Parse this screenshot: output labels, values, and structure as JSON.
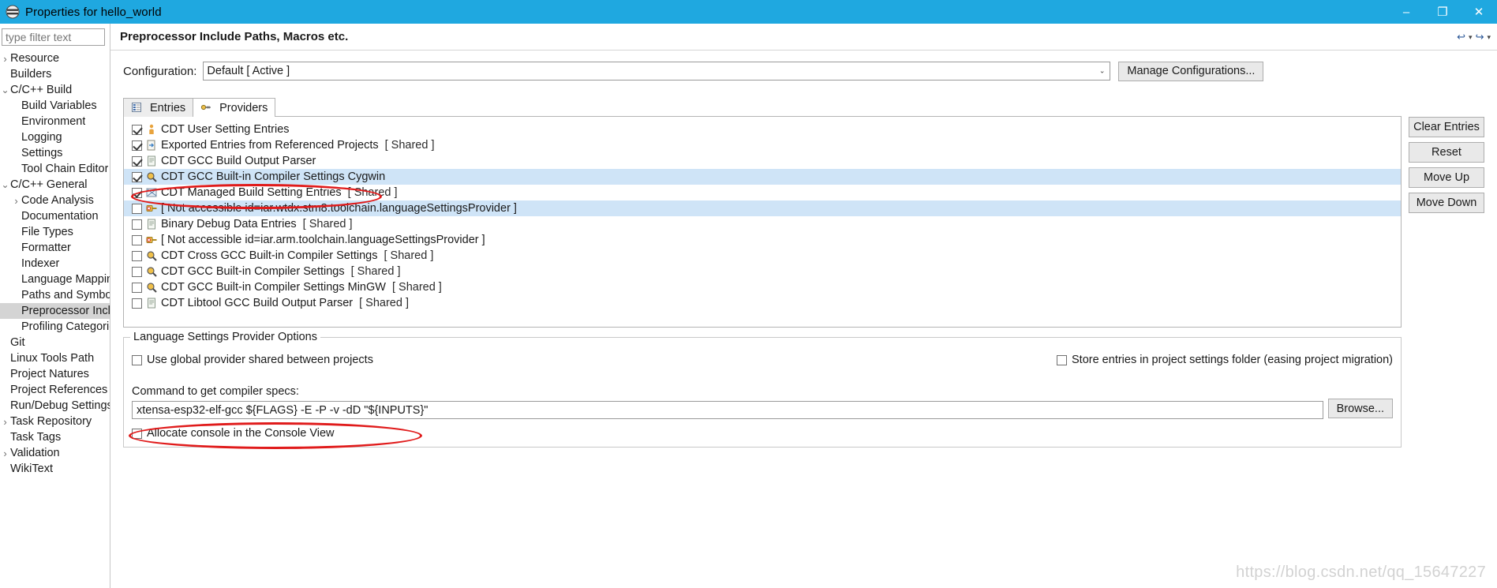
{
  "window": {
    "title": "Properties for hello_world",
    "icon": "eclipse-properties-icon",
    "minimize": "–",
    "maximize": "❐",
    "close": "✕",
    "titlebar_color": "#1fa8e0"
  },
  "sidebar": {
    "filter_placeholder": "type filter text",
    "filter_value": "",
    "items": [
      {
        "label": "Resource",
        "indent": 0,
        "twisty": "collapsed",
        "selected": false
      },
      {
        "label": "Builders",
        "indent": 0,
        "twisty": "none",
        "selected": false
      },
      {
        "label": "C/C++ Build",
        "indent": 0,
        "twisty": "expanded",
        "selected": false
      },
      {
        "label": "Build Variables",
        "indent": 1,
        "twisty": "none",
        "selected": false
      },
      {
        "label": "Environment",
        "indent": 1,
        "twisty": "none",
        "selected": false
      },
      {
        "label": "Logging",
        "indent": 1,
        "twisty": "none",
        "selected": false
      },
      {
        "label": "Settings",
        "indent": 1,
        "twisty": "none",
        "selected": false
      },
      {
        "label": "Tool Chain Editor",
        "indent": 1,
        "twisty": "none",
        "selected": false
      },
      {
        "label": "C/C++ General",
        "indent": 0,
        "twisty": "expanded",
        "selected": false
      },
      {
        "label": "Code Analysis",
        "indent": 1,
        "twisty": "collapsed",
        "selected": false
      },
      {
        "label": "Documentation",
        "indent": 1,
        "twisty": "none",
        "selected": false
      },
      {
        "label": "File Types",
        "indent": 1,
        "twisty": "none",
        "selected": false
      },
      {
        "label": "Formatter",
        "indent": 1,
        "twisty": "none",
        "selected": false
      },
      {
        "label": "Indexer",
        "indent": 1,
        "twisty": "none",
        "selected": false
      },
      {
        "label": "Language Mappings",
        "indent": 1,
        "twisty": "none",
        "selected": false
      },
      {
        "label": "Paths and Symbols",
        "indent": 1,
        "twisty": "none",
        "selected": false
      },
      {
        "label": "Preprocessor Include",
        "indent": 1,
        "twisty": "none",
        "selected": true
      },
      {
        "label": "Profiling Categories",
        "indent": 1,
        "twisty": "none",
        "selected": false
      },
      {
        "label": "Git",
        "indent": 0,
        "twisty": "none",
        "selected": false
      },
      {
        "label": "Linux Tools Path",
        "indent": 0,
        "twisty": "none",
        "selected": false
      },
      {
        "label": "Project Natures",
        "indent": 0,
        "twisty": "none",
        "selected": false
      },
      {
        "label": "Project References",
        "indent": 0,
        "twisty": "none",
        "selected": false
      },
      {
        "label": "Run/Debug Settings",
        "indent": 0,
        "twisty": "none",
        "selected": false
      },
      {
        "label": "Task Repository",
        "indent": 0,
        "twisty": "collapsed",
        "selected": false
      },
      {
        "label": "Task Tags",
        "indent": 0,
        "twisty": "none",
        "selected": false
      },
      {
        "label": "Validation",
        "indent": 0,
        "twisty": "collapsed",
        "selected": false
      },
      {
        "label": "WikiText",
        "indent": 0,
        "twisty": "none",
        "selected": false
      }
    ]
  },
  "page": {
    "title": "Preprocessor Include Paths, Macros etc.",
    "nav": {
      "back": "↩",
      "back_caret": "▾",
      "forward": "↪",
      "forward_caret": "▾"
    }
  },
  "configuration": {
    "label": "Configuration:",
    "value": "Default  [ Active ]",
    "arrow": "⌄",
    "manage_button": "Manage Configurations..."
  },
  "tabs": [
    {
      "label": "Entries",
      "icon": "entries-icon",
      "active": false
    },
    {
      "label": "Providers",
      "icon": "providers-icon",
      "active": true
    }
  ],
  "providers": [
    {
      "label": "CDT User Setting Entries",
      "checked": true,
      "shared": "",
      "icon": "person-icon",
      "highlight": false
    },
    {
      "label": "Exported Entries from Referenced Projects",
      "checked": true,
      "shared": "[ Shared ]",
      "icon": "export-icon",
      "highlight": false
    },
    {
      "label": "CDT GCC Build Output Parser",
      "checked": true,
      "shared": "",
      "icon": "parser-icon",
      "highlight": false
    },
    {
      "label": "CDT GCC Built-in Compiler Settings Cygwin",
      "checked": true,
      "shared": "",
      "icon": "magnifier-icon",
      "highlight": true
    },
    {
      "label": "CDT Managed Build Setting Entries",
      "checked": true,
      "shared": "[ Shared ]",
      "icon": "managed-icon",
      "highlight": false
    },
    {
      "label": "[ Not accessible id=iar.wtdx.stm8.toolchain.languageSettingsProvider ]",
      "checked": false,
      "shared": "",
      "icon": "error-plug-icon",
      "highlight": true
    },
    {
      "label": "Binary Debug Data Entries",
      "checked": false,
      "shared": "[ Shared ]",
      "icon": "parser-icon",
      "highlight": false
    },
    {
      "label": "[ Not accessible id=iar.arm.toolchain.languageSettingsProvider ]",
      "checked": false,
      "shared": "",
      "icon": "error-plug-icon",
      "highlight": false
    },
    {
      "label": "CDT Cross GCC Built-in Compiler Settings",
      "checked": false,
      "shared": "[ Shared ]",
      "icon": "magnifier-icon",
      "highlight": false
    },
    {
      "label": "CDT GCC Built-in Compiler Settings",
      "checked": false,
      "shared": "[ Shared ]",
      "icon": "magnifier-icon",
      "highlight": false
    },
    {
      "label": "CDT GCC Built-in Compiler Settings MinGW",
      "checked": false,
      "shared": "[ Shared ]",
      "icon": "magnifier-icon",
      "highlight": false
    },
    {
      "label": "CDT Libtool GCC Build Output Parser",
      "checked": false,
      "shared": "[ Shared ]",
      "icon": "parser-icon",
      "highlight": false
    }
  ],
  "side_buttons": [
    {
      "label": "Clear Entries"
    },
    {
      "label": "Reset"
    },
    {
      "label": "Move Up"
    },
    {
      "label": "Move Down"
    }
  ],
  "options": {
    "legend": "Language Settings Provider Options",
    "use_global": {
      "label": "Use global provider shared between projects",
      "checked": false
    },
    "store_entries": {
      "label": "Store entries in project settings folder (easing project migration)",
      "checked": false
    },
    "command_label": "Command to get compiler specs:",
    "command_value": "xtensa-esp32-elf-gcc ${FLAGS} -E -P -v -dD \"${INPUTS}\"",
    "browse_button": "Browse...",
    "allocate_console": {
      "label": "Allocate console in the Console View",
      "checked": false
    }
  },
  "annotations": {
    "highlight_color": "#e01b1b",
    "ellipse_provider_row": "CDT GCC Built-in Compiler Settings Cygwin",
    "ellipse_command_field": "xtensa-esp32-elf-gcc ${FLAGS} -E -P -v -dD \"${INPUTS}\""
  },
  "watermark": "https://blog.csdn.net/qq_15647227"
}
